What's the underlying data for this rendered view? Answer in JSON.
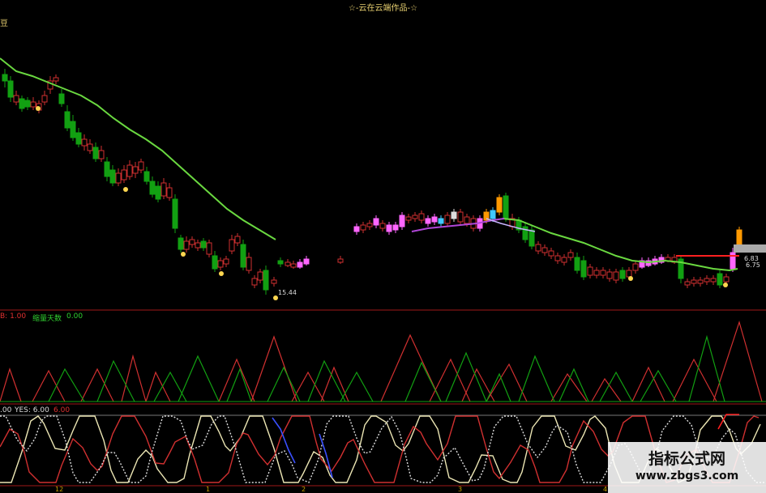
{
  "header": {
    "title": "☆-云在云端作品-☆",
    "corner_tag": "豆"
  },
  "main_panel": {
    "low_price_label": "15.44",
    "price_tag": "6.83",
    "price_tag_2": "6.75"
  },
  "volume_panel": {
    "prefix": "B: 1.00",
    "label": "缩量天数",
    "value": "0.00"
  },
  "bottom_panel": {
    "prefix": ".00",
    "yes_label": "YES: 6.00",
    "value": "6.00"
  },
  "x_axis": {
    "ticks": [
      "12",
      "1",
      "2",
      "3",
      "4"
    ]
  },
  "watermark": {
    "title": "指标公式网",
    "url": "www.zbgs3.com"
  },
  "colors": {
    "up": "#d03030",
    "down": "#12a012",
    "ma": "#6ad840",
    "pink": "#ff66ff",
    "orange": "#ff9900",
    "cyan": "#40c8ff",
    "ma_purple": "#b046d8",
    "ma_lilac": "#c8b4ff",
    "gold": "#ffd750",
    "cream": "#ece6b4",
    "blue": "#3a50ff"
  },
  "chart_data": [
    {
      "type": "candlestick",
      "title": "☆-云在云端作品-☆",
      "annotations": [
        "15.44",
        "6.83",
        "6.75"
      ],
      "series": [
        {
          "name": "",
          "values": []
        }
      ]
    },
    {
      "type": "line",
      "series": [
        {
          "name": "缩量天数",
          "values": [
            0
          ]
        }
      ]
    },
    {
      "type": "line",
      "series": [
        {
          "name": "YES",
          "values": [
            6
          ]
        }
      ]
    }
  ]
}
